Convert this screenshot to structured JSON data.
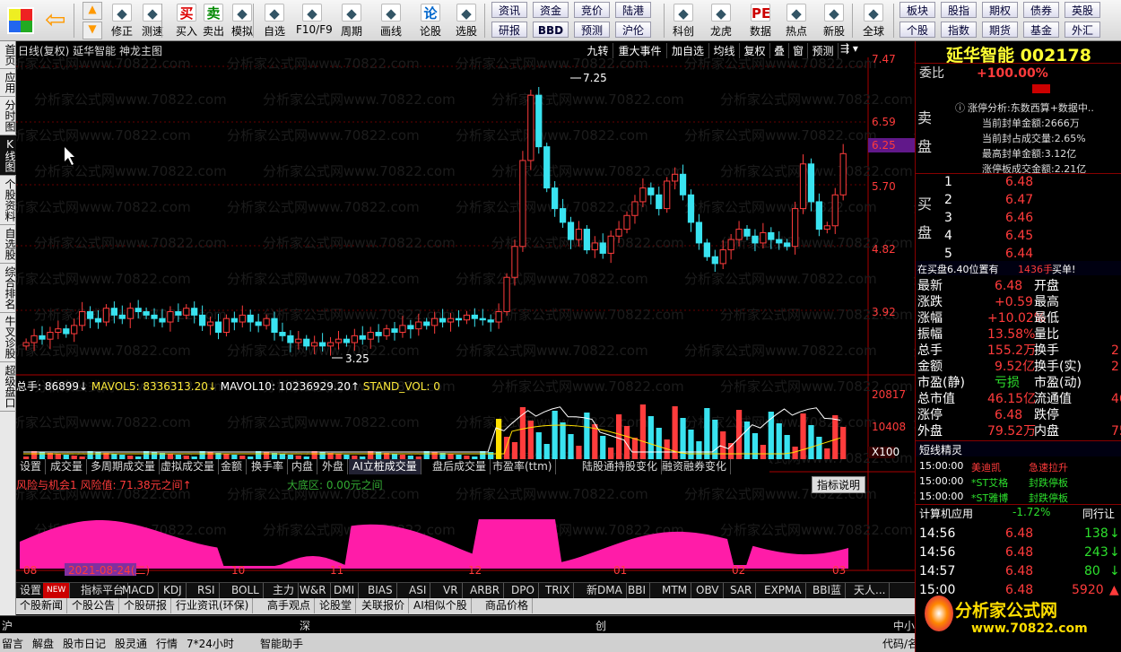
{
  "toolbar": {
    "buttons": [
      {
        "label": "修正",
        "icon": "clock-icon"
      },
      {
        "label": "测速",
        "icon": "stopwatch-icon"
      },
      {
        "label": "买入",
        "icon": "buy-icon",
        "glyph": "买"
      },
      {
        "label": "卖出",
        "icon": "sell-icon",
        "glyph": "卖"
      },
      {
        "label": "模拟",
        "icon": "gavel-icon"
      },
      {
        "label": "自选",
        "icon": "list-icon"
      },
      {
        "label": "F10/F9",
        "icon": "doc-icon"
      },
      {
        "label": "周期",
        "icon": "clock2-icon"
      },
      {
        "label": "画线",
        "icon": "pencil-icon"
      },
      {
        "label": "论股",
        "icon": "chat-icon",
        "glyph": "论"
      },
      {
        "label": "选股",
        "icon": "scan-icon"
      },
      {
        "label": "科创",
        "icon": "chart-icon"
      },
      {
        "label": "龙虎",
        "icon": "dragon-icon"
      },
      {
        "label": "数据",
        "icon": "pe-icon",
        "glyph": "PE"
      },
      {
        "label": "热点",
        "icon": "hot-icon"
      },
      {
        "label": "新股",
        "icon": "ipo-icon"
      },
      {
        "label": "全球",
        "icon": "globe-icon"
      }
    ],
    "grid1": [
      "资讯",
      "资金",
      "竞价",
      "陆港",
      "板块",
      "股指",
      "期权",
      "债券",
      "英股"
    ],
    "grid2": [
      "研报",
      "BBD",
      "预测",
      "沪伦",
      "个股",
      "指数",
      "期货",
      "基金",
      "外汇"
    ]
  },
  "side_tabs": [
    "首页",
    "应用",
    "分时图",
    "K线图",
    "个股资料",
    "自选股",
    "综合排名",
    "牛叉诊股",
    "超级盘口"
  ],
  "chart": {
    "header": "日线(复权)  延华智能  神龙主图",
    "header_btns": [
      "九转",
      "重大事件",
      "加自选",
      "均线",
      "复权",
      "叠",
      "窗",
      "预测"
    ],
    "watermark": "分析家公式网www.70822.com",
    "price_labels": [
      "7.47",
      "6.59",
      "6.25",
      "5.70",
      "4.82",
      "3.92"
    ],
    "max_label": "7.25",
    "min_label": "3.25",
    "vol_header": {
      "a": "总手: 86899↓",
      "b": "MAVOL5: 8336313.20↓",
      "c": "MAVOL10: 10236929.20↑",
      "d": "STAND_VOL: 0"
    },
    "vol_labels": [
      "20817",
      "10408",
      "X100"
    ],
    "sub_tabs": [
      "设置",
      "成交量",
      "多周期成交量",
      "虚拟成交量",
      "金额",
      "换手率",
      "内盘",
      "外盘",
      "AI立桩成交量",
      "盘后成交量",
      "市盈率(ttm)",
      "陆股通持股变化",
      "融资融券变化"
    ],
    "risk_title": "风险与机会1  风险值: 71.38元之间↑",
    "risk_mid": "大底区: 0.00元之间",
    "risk_btn": "指标说明",
    "dates": [
      "08",
      "2021-08-24(二)",
      "10",
      "11",
      "12",
      "01",
      "02",
      "03"
    ]
  },
  "indicators": [
    "设置",
    "NEW",
    "指标平台",
    "MACD",
    "KDJ",
    "RSI",
    "BOLL",
    "主力",
    "W&R",
    "DMI",
    "BIAS",
    "ASI",
    "VR",
    "ARBR",
    "DPO",
    "TRIX",
    "新DMA",
    "BBI",
    "MTM",
    "OBV",
    "SAR",
    "EXPMA",
    "BBI蓝",
    "天人..."
  ],
  "bottom_tabs": [
    "个股新闻",
    "个股公告",
    "个股研报",
    "行业资讯(环保)",
    "高手观点",
    "论股堂",
    "关联报价",
    "AI相似个股",
    "商品价格"
  ],
  "bot2": [
    "沪",
    "深",
    "创"
  ],
  "bot2_right": "中小板",
  "status": [
    "留言",
    "解盘",
    "股市日记",
    "股灵通",
    "行情",
    "7*24小时",
    "智能助手"
  ],
  "status_right": "代码/名称",
  "right": {
    "name": "延华智能",
    "code": "002178",
    "weibi_label": "委比",
    "weibi": "+100.00%",
    "sell_label": [
      "卖",
      "盘"
    ],
    "buy_label": [
      "买",
      "盘"
    ],
    "analysis": [
      "涨停分析:东数西算+数据中..",
      "当前封单金额:2666万",
      "当前封占成交量:2.65%",
      "最高封单金额:3.12亿",
      "涨停板成交金额:2.21亿"
    ],
    "bids": [
      {
        "n": "1",
        "p": "6.48"
      },
      {
        "n": "2",
        "p": "6.47"
      },
      {
        "n": "3",
        "p": "6.46"
      },
      {
        "n": "4",
        "p": "6.45"
      },
      {
        "n": "5",
        "p": "6.44"
      }
    ],
    "bid_note": "在买盘6.40位置有",
    "bid_qty": "1436手",
    "bid_tag": "买单!",
    "quote": [
      {
        "l": "最新",
        "v": "6.48",
        "r": "开盘"
      },
      {
        "l": "涨跌",
        "v": "+0.59",
        "r": "最高"
      },
      {
        "l": "涨幅",
        "v": "+10.02%",
        "r": "最低"
      },
      {
        "l": "振幅",
        "v": "13.58%",
        "r": "量比"
      },
      {
        "l": "总手",
        "v": "155.2万",
        "r": "换手",
        "rv": "2"
      },
      {
        "l": "金额",
        "v": "9.52亿",
        "r": "换手(实)",
        "rv": "2"
      },
      {
        "l": "市盈(静)",
        "v": "亏损",
        "r": "市盈(动)"
      },
      {
        "l": "总市值",
        "v": "46.15亿",
        "r": "流通值",
        "rv": "46"
      },
      {
        "l": "涨停",
        "v": "6.48",
        "r": "跌停"
      },
      {
        "l": "外盘",
        "v": "79.52万",
        "r": "内盘",
        "rv": "75"
      }
    ],
    "short_title": "短线精灵",
    "short": [
      {
        "t": "15:00:00",
        "n": "美迪凯",
        "e": "急速拉升"
      },
      {
        "t": "15:00:00",
        "n": "*ST艾格",
        "e": "封跌停板"
      },
      {
        "t": "15:00:00",
        "n": "*ST雅博",
        "e": "封跌停板"
      }
    ],
    "ind_name": "计算机应用",
    "ind_chg": "-1.72%",
    "ind_right": "同行让",
    "ticks": [
      {
        "t": "14:56",
        "p": "6.48",
        "v": "138"
      },
      {
        "t": "14:56",
        "p": "6.48",
        "v": "243"
      },
      {
        "t": "14:57",
        "p": "6.48",
        "v": "80"
      },
      {
        "t": "15:00",
        "p": "6.48",
        "v": "5920"
      }
    ],
    "logo": "分析家公式网",
    "logo_url": "www.70822.com"
  }
}
